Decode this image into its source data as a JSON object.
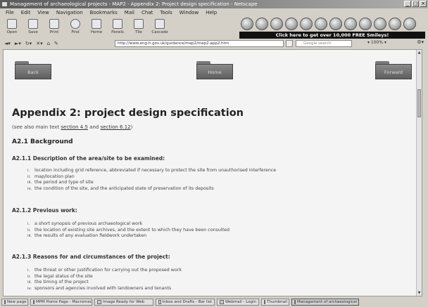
{
  "window": {
    "title": "Management of archaeological projects - MAP2 - Appendix 2: Project design specification - Netscape",
    "controls": [
      "_",
      "□",
      "×"
    ]
  },
  "menubar": {
    "items": [
      "File",
      "Edit",
      "View",
      "Navigation",
      "Bookmarks",
      "Mail",
      "Chat",
      "Tools",
      "Window",
      "Help"
    ]
  },
  "toolbar": {
    "buttons": [
      "Open",
      "Save",
      "Print",
      "Find",
      "Home",
      "Panels",
      "Tile",
      "Cascade"
    ]
  },
  "banner": {
    "text": "Click here to get over 10,000 FREE Smileys!"
  },
  "addressbar": {
    "url": "http://www.eng-h.gov.uk/guidance/map2/map2-app2.htm",
    "search_placeholder": "Google search",
    "zoom": "100%"
  },
  "page": {
    "nav_folders": [
      "Back",
      "Home",
      "Forward"
    ],
    "title": "Appendix 2: project design specification",
    "see_also_prefix": "(see also main text ",
    "see_also_link1": "section 4.5",
    "see_also_mid": " and ",
    "see_also_link2": "section 6.12",
    "see_also_suffix": ")",
    "background_heading": "A2.1 Background",
    "sections": [
      {
        "heading": "A2.1.1 Description of the area/site to be examined:",
        "items": [
          "location including grid reference, abbreviated if necessary to protect the site from unauthorised interference",
          "map/location plan",
          "the period and type of site",
          "the condition of the site, and the anticipated state of preservation of its deposits"
        ]
      },
      {
        "heading": "A2.1.2 Previous work:",
        "items": [
          "a short synopsis of previous archaeological work",
          "the location of existing site archives, and the extent to which they have been consulted",
          "the results of any evaluation fieldwork undertaken"
        ]
      },
      {
        "heading": "A2.1.3 Reasons for and circumstances of the project:",
        "items": [
          "the threat or other justification for carrying out the proposed work",
          "the legal status of the site",
          "the timing of the project",
          "sponsors and agencies involved with landowners and tenants"
        ]
      }
    ],
    "list_marks": [
      "i.",
      "ii.",
      "iii.",
      "iv."
    ]
  },
  "statusbar": {
    "tasks": [
      "New page",
      "MPM Home Page - Macromedia",
      "Image Ready for Web",
      "Inbox and Drafts - Bar list",
      "Webmail - Login",
      "Thumbnail",
      "Management of archaeological projects"
    ]
  }
}
